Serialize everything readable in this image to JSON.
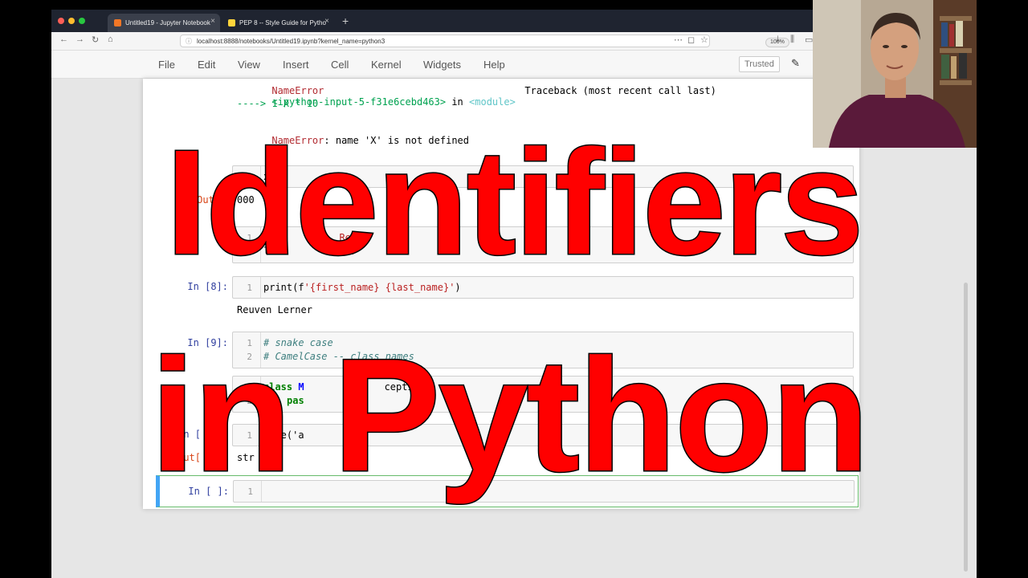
{
  "browser": {
    "tabs": [
      {
        "label": "Untitled19 - Jupyter Notebook",
        "close": "×"
      },
      {
        "label": "PEP 8 -- Style Guide for Pytho",
        "close": "×"
      }
    ],
    "new_tab": "+",
    "url": "localhost:8888/notebooks/Untitled19.ipynb?kernel_name=python3",
    "zoom": "100%"
  },
  "menu": {
    "items": [
      "File",
      "Edit",
      "View",
      "Insert",
      "Cell",
      "Kernel",
      "Widgets",
      "Help"
    ],
    "trusted": "Trusted"
  },
  "notebook": {
    "traceback": {
      "error_header": "NameError",
      "traceback_label": "Traceback (most recent call last)",
      "input_ref": "<ipython-input-5-f31e6cebd463>",
      "in_word": " in ",
      "module": "<module>",
      "arrow_line": "----> 1 X * 10",
      "error_name": "NameError",
      "error_msg": ": name 'X' is not defined"
    },
    "cells": [
      {
        "prompt": "In [8]:",
        "lines": [
          "1"
        ],
        "code": "print(f'{first_name} {last_name}')",
        "output": "Reuven Lerner"
      },
      {
        "prompt": "In [9]:",
        "lines": [
          "1",
          "2"
        ],
        "code": [
          "# snake case",
          "# CamelCase -- class names"
        ]
      },
      {
        "prompt": "In [ ]:",
        "lines": [
          "1"
        ]
      }
    ],
    "partial": {
      "cell1_code": "x",
      "out1_prompt": "Out[",
      "out1_value": "000",
      "cell2_line1": "fi",
      "cell2_line1_end": "Re",
      "cell2_line2": "la",
      "cell2_line2_end": "Ler",
      "class_kw": "class",
      "class_name": " M",
      "class_rest": "ception:",
      "pass_kw": "pas",
      "in_prompt_partial": "In [",
      "type_code": "type('a",
      "out2_prompt": "Out[",
      "out2_value": "str"
    }
  },
  "overlay": {
    "line1": "Identifiers",
    "line2": "in Python",
    "color": "#ff0000"
  }
}
